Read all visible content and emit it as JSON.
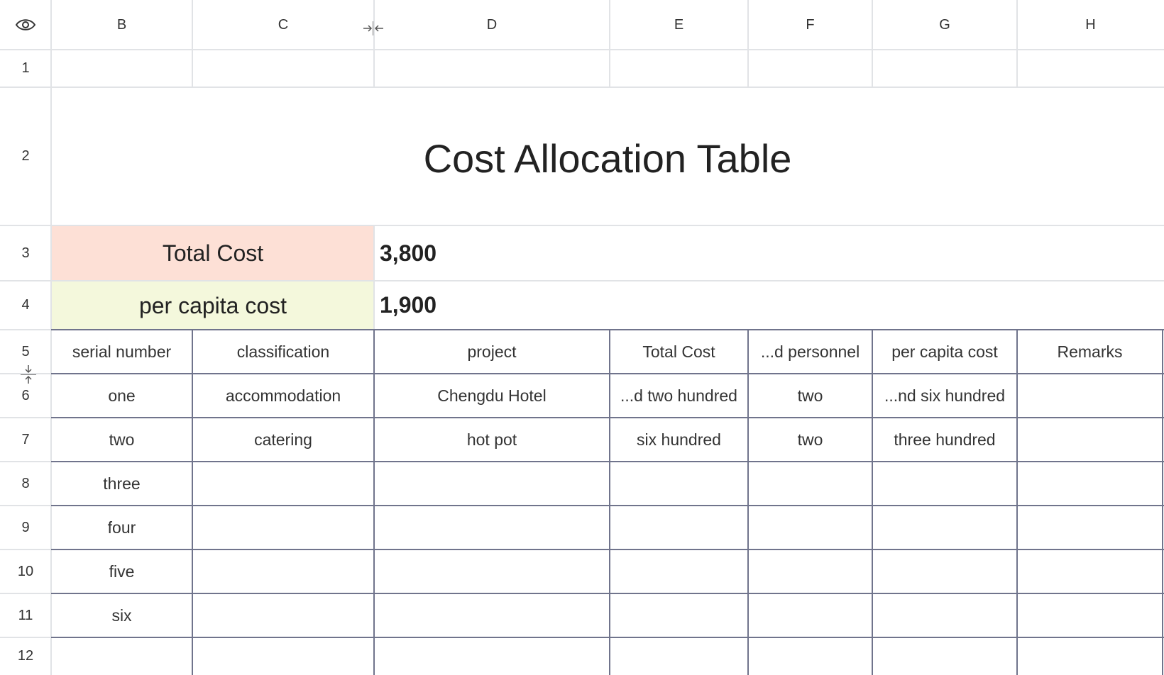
{
  "columns": [
    "B",
    "C",
    "D",
    "E",
    "F",
    "G",
    "H"
  ],
  "rows": [
    "1",
    "2",
    "3",
    "4",
    "5",
    "6",
    "7",
    "8",
    "9",
    "10",
    "11",
    "12"
  ],
  "title": "Cost Allocation Table",
  "summary": {
    "total_cost_label": "Total Cost",
    "total_cost_value": "3,800",
    "per_capita_label": "per capita cost",
    "per_capita_value": "1,900"
  },
  "table": {
    "headers": [
      "serial number",
      "classification",
      "project",
      "Total Cost",
      "...d personnel",
      "per capita cost",
      "Remarks"
    ],
    "rows": [
      [
        "one",
        "accommodation",
        "Chengdu Hotel",
        "...d two hundred",
        "two",
        "...nd six hundred",
        ""
      ],
      [
        "two",
        "catering",
        "hot pot",
        "six hundred",
        "two",
        "three hundred",
        ""
      ],
      [
        "three",
        "",
        "",
        "",
        "",
        "",
        ""
      ],
      [
        "four",
        "",
        "",
        "",
        "",
        "",
        ""
      ],
      [
        "five",
        "",
        "",
        "",
        "",
        "",
        ""
      ],
      [
        "six",
        "",
        "",
        "",
        "",
        "",
        ""
      ],
      [
        "",
        "",
        "",
        "",
        "",
        "",
        ""
      ]
    ]
  },
  "colors": {
    "total_cost_fill": "#fde0d6",
    "per_capita_fill": "#f4f8dc",
    "grid_light": "#e1e3e6",
    "grid_dark": "#70748c"
  },
  "icons": {
    "corner": "eye-icon",
    "col_resize": "column-resize-icon",
    "row_resize": "row-resize-icon"
  }
}
